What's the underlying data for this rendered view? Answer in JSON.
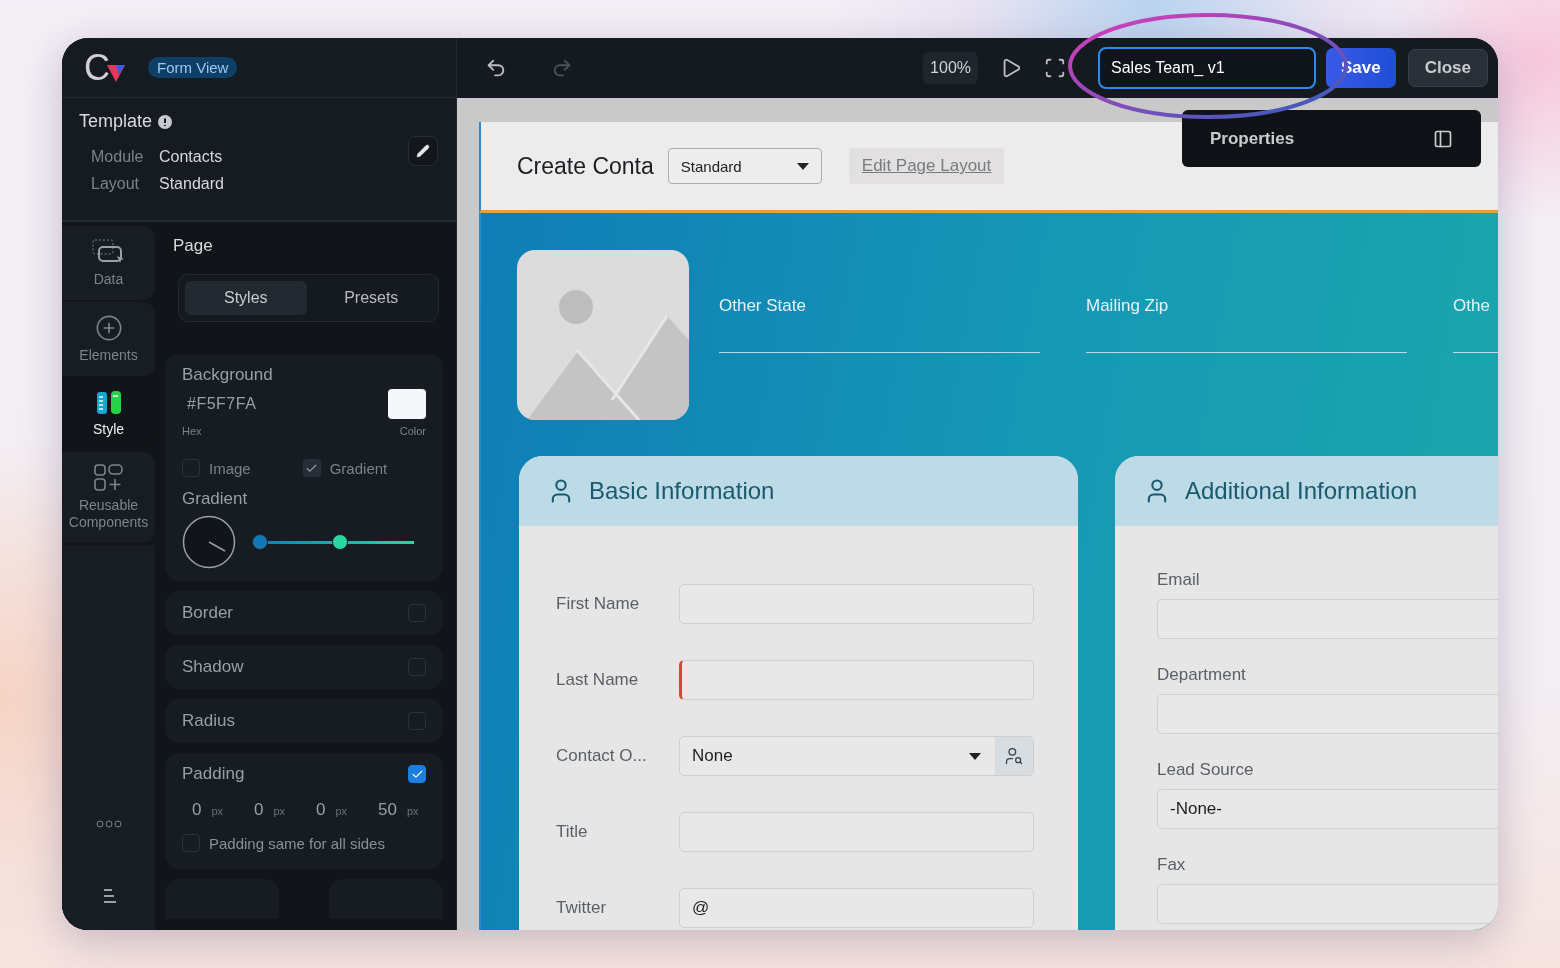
{
  "app": {
    "logo": "C",
    "badge": "Form View"
  },
  "template": {
    "title": "Template",
    "rows": [
      {
        "label": "Module",
        "value": "Contacts"
      },
      {
        "label": "Layout",
        "value": "Standard"
      }
    ]
  },
  "nav": [
    {
      "kind": "data",
      "label": "Data",
      "selected": false
    },
    {
      "kind": "elements",
      "label": "Elements",
      "selected": false
    },
    {
      "kind": "style",
      "label": "Style",
      "selected": true
    },
    {
      "kind": "components",
      "label": "Reusable Components",
      "selected": false
    }
  ],
  "panel": {
    "title": "Page",
    "tabs": [
      {
        "label": "Styles",
        "selected": true
      },
      {
        "label": "Presets",
        "selected": false
      }
    ],
    "background": {
      "title": "Background",
      "hex": "#F5F7FA",
      "hex_label": "Hex",
      "color_label": "Color",
      "options": [
        {
          "label": "Image",
          "checked": false
        },
        {
          "label": "Gradient",
          "checked": true
        }
      ],
      "gradient_title": "Gradient",
      "stops": [
        {
          "level": 0
        },
        {
          "level": 0.55
        }
      ]
    },
    "toggles": [
      {
        "label": "Border",
        "checked": false
      },
      {
        "label": "Shadow",
        "checked": false
      },
      {
        "label": "Radius",
        "checked": false
      }
    ],
    "padding": {
      "label": "Padding",
      "checked": true,
      "values": [
        {
          "value": "0",
          "unit": "px"
        },
        {
          "value": "0",
          "unit": "px"
        },
        {
          "value": "0",
          "unit": "px"
        },
        {
          "value": "50",
          "unit": "px"
        }
      ],
      "same": {
        "label": "Padding same for all sides",
        "checked": false
      }
    }
  },
  "toolbar": {
    "undo": {
      "disabled": false
    },
    "redo": {
      "disabled": true
    },
    "zoom": "100%",
    "name": "Sales Team_ v1",
    "save": "Save",
    "close": "Close"
  },
  "properties": {
    "label": "Properties"
  },
  "form": {
    "title": "Create Conta",
    "layout": "Standard",
    "edit_link": "Edit Page Layout",
    "top_fields": [
      "Other State",
      "Mailing Zip",
      "Othe"
    ],
    "sections": [
      {
        "title": "Basic Information",
        "kind": "inline",
        "fields": [
          {
            "label": "First Name",
            "kind": "text",
            "required": false
          },
          {
            "label": "Last Name",
            "kind": "text",
            "required": true
          },
          {
            "label": "Contact O...",
            "kind": "lookup",
            "value": "None",
            "required": false
          },
          {
            "label": "Title",
            "kind": "text",
            "required": false
          },
          {
            "label": "Twitter",
            "kind": "text",
            "value": "@",
            "required": false
          }
        ]
      },
      {
        "title": "Additional Information",
        "kind": "stacked",
        "fields": [
          {
            "label": "Email",
            "kind": "text",
            "required": false
          },
          {
            "label": "Department",
            "kind": "text",
            "required": false
          },
          {
            "label": "Lead Source",
            "kind": "text",
            "value": "-None-",
            "required": false
          },
          {
            "label": "Fax",
            "kind": "text",
            "required": false
          }
        ]
      }
    ]
  }
}
